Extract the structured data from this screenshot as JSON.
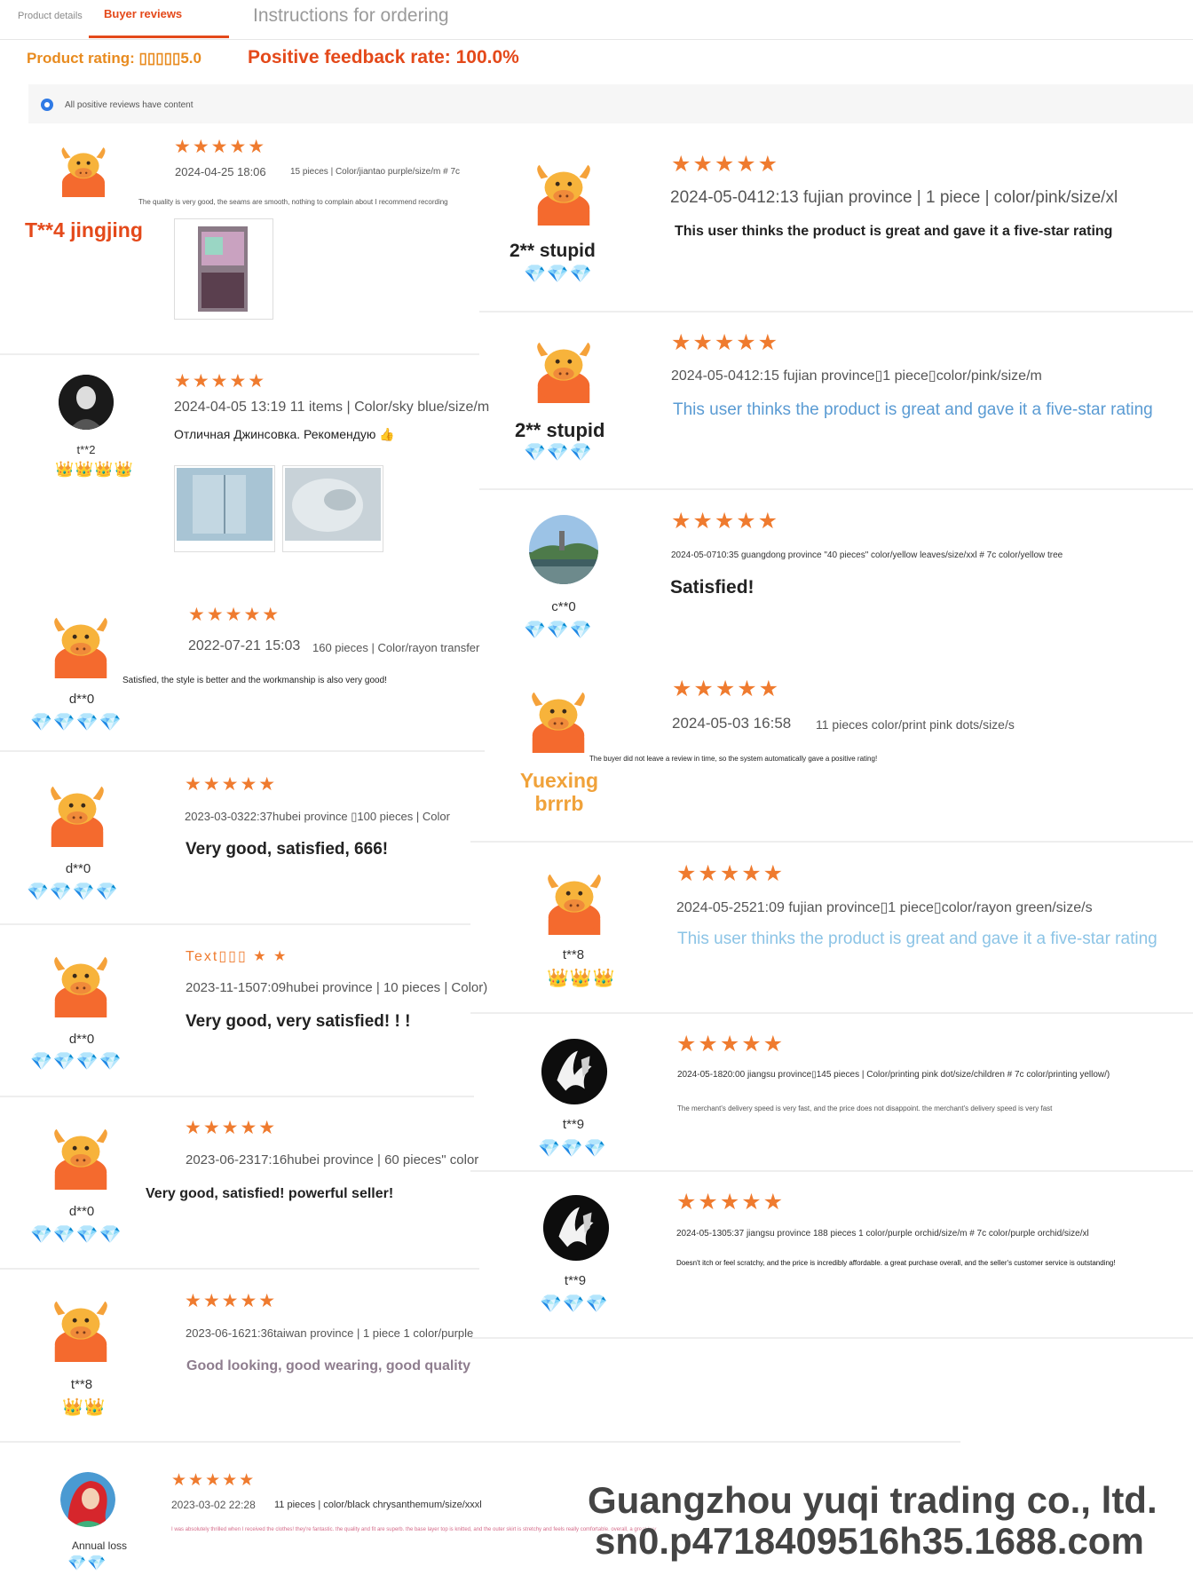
{
  "tabs": {
    "product_details": "Product details",
    "buyer_reviews": "Buyer reviews",
    "instructions": "Instructions for ordering"
  },
  "summary": {
    "rating": "Product rating: ▯▯▯▯▯5.0",
    "feedback": "Positive feedback rate: 100.0%"
  },
  "filter": {
    "label": "All positive reviews have content"
  },
  "colors": {
    "accent": "#e4491a",
    "star": "#ef7b2f",
    "gem": "#f2a228",
    "link_blue": "#5a9bd3"
  },
  "reviews_left": [
    {
      "user": "T**4 jingjing",
      "stars": "★★★★★",
      "date": "2024-04-25 18:06",
      "spec": "15 pieces | Color/jiantao purple/size/m # 7c",
      "text": "The quality is very good, the seams are smooth, nothing to complain about I recommend recording",
      "avatar": "cow-avatar-icon",
      "has_images": true
    },
    {
      "user": "t**2",
      "stars": "★★★★★",
      "level": "👑👑👑👑",
      "date": "2024-04-05 13:19 11 items | Color/sky blue/size/m",
      "text": "Отличная Джинсовка. Рекомендую 👍",
      "avatar": "photo-avatar-icon",
      "has_images": true
    },
    {
      "user": "d**0",
      "stars": "★★★★★",
      "level": "💎💎💎💎",
      "date": "2022-07-21 15:03",
      "spec": "160 pieces | Color/rayon transfer",
      "text": "Satisfied, the style is better and the workmanship is also very good!"
    },
    {
      "user": "d**0",
      "stars": "★★★★★",
      "level": "💎💎💎💎",
      "date": "2023-03-0322:37hubei province ▯100 pieces | Color",
      "text": "Very good, satisfied, 666!"
    },
    {
      "user": "d**0",
      "stars": "Text▯▯▯ ★ ★",
      "level": "💎💎💎💎",
      "date": "2023-11-1507:09hubei province | 10 pieces | Color)",
      "text": "Very good, very satisfied! ! !"
    },
    {
      "user": "d**0",
      "stars": "★★★★★",
      "level": "💎💎💎💎",
      "date": "2023-06-2317:16hubei province | 60 pieces\" color",
      "text": "Very good, satisfied! powerful seller!"
    },
    {
      "user": "t**8",
      "stars": "★★★★★",
      "level": "👑👑",
      "date": "2023-06-1621:36taiwan province | 1 piece 1 color/purple",
      "text": "Good looking, good wearing, good quality"
    },
    {
      "user": "Annual loss",
      "stars": "★★★★★",
      "level": "💎💎",
      "date": "2023-03-02 22:28",
      "spec": "11 pieces | color/black chrysanthemum/size/xxxl",
      "text": "I was absolutely thrilled when I received the clothes! they're fantastic. the quality and fit are superb. the base layer top is knitted, and the outer skirt is stretchy and feels really comfortable. overall, a great buy"
    }
  ],
  "reviews_right": [
    {
      "user": "2** stupid",
      "stars": "★★★★★",
      "level": "💎💎💎",
      "date": "2024-05-0412:13 fujian province | 1 piece | color/pink/size/xl",
      "text": "This user thinks the product is great and gave it a five-star rating"
    },
    {
      "user": "2** stupid",
      "stars": "★★★★★",
      "level": "💎💎💎",
      "date": "2024-05-0412:15 fujian province▯1 piece▯color/pink/size/m",
      "text": "This user thinks the product is great and gave it a five-star rating"
    },
    {
      "user": "c**0",
      "stars": "★★★★★",
      "level": "💎💎💎",
      "date": "2024-05-0710:35 guangdong province \"40 pieces\" color/yellow leaves/size/xxl # 7c color/yellow tree",
      "text": "Satisfied!"
    },
    {
      "user": "Yuexing brrrb",
      "stars": "★★★★★",
      "date": "2024-05-03 16:58",
      "spec": "11 pieces color/print pink dots/size/s",
      "text": "The buyer did not leave a review in time, so the system automatically gave a positive rating!"
    },
    {
      "user": "t**8",
      "stars": "★★★★★",
      "level": "👑👑👑",
      "date": "2024-05-2521:09 fujian province▯1 piece▯color/rayon green/size/s",
      "text": "This user thinks the product is great and gave it a five-star rating"
    },
    {
      "user": "t**9",
      "stars": "★★★★★",
      "level": "💎💎💎",
      "date": "2024-05-1820:00 jiangsu province▯145 pieces | Color/printing pink dot/size/children # 7c color/printing yellow/)",
      "text": "The merchant's delivery speed is very fast, and the price does not disappoint. the merchant's delivery speed is very fast"
    },
    {
      "user": "t**9",
      "stars": "★★★★★",
      "level": "💎💎💎",
      "date": "2024-05-1305:37 jiangsu province 188 pieces 1 color/purple orchid/size/m # 7c color/purple orchid/size/xl",
      "text": "Doesn't itch or feel scratchy, and the price is incredibly affordable. a great purchase overall, and the seller's customer service is outstanding!"
    }
  ],
  "watermark": {
    "company": "Guangzhou yuqi trading co., ltd.",
    "url": "sn0.p4718409516h35.1688.com"
  }
}
